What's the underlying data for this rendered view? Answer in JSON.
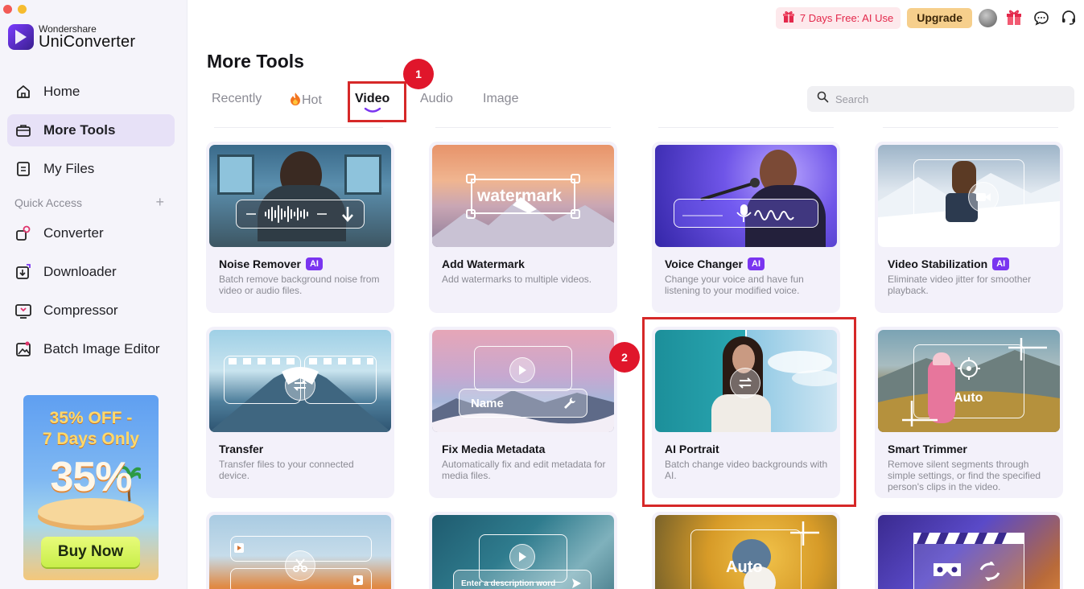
{
  "app": {
    "brand": "Wondershare",
    "product": "UniConverter"
  },
  "topbar": {
    "trial_label": "7 Days Free: AI Use",
    "upgrade_label": "Upgrade"
  },
  "sidebar": {
    "items": [
      {
        "label": "Home",
        "icon": "home-icon"
      },
      {
        "label": "More Tools",
        "icon": "toolbox-icon",
        "active": true
      },
      {
        "label": "My Files",
        "icon": "file-icon"
      }
    ],
    "quick_access_label": "Quick Access",
    "quick_items": [
      {
        "label": "Converter",
        "icon": "converter-icon"
      },
      {
        "label": "Downloader",
        "icon": "downloader-icon"
      },
      {
        "label": "Compressor",
        "icon": "compressor-icon"
      },
      {
        "label": "Batch Image Editor",
        "icon": "image-editor-icon"
      }
    ]
  },
  "promo": {
    "line1": "35% OFF -",
    "line2": "7 Days Only",
    "big": "35%",
    "button": "Buy Now"
  },
  "main": {
    "title": "More Tools",
    "tabs": [
      "Recently",
      "Hot",
      "Video",
      "Audio",
      "Image"
    ],
    "active_tab": "Video",
    "search_placeholder": "Search"
  },
  "annotations": {
    "badge1": "1",
    "badge2": "2"
  },
  "thumb_text": {
    "watermark": "watermark",
    "name": "Name",
    "auto": "Auto",
    "description": "Enter a description word"
  },
  "cards": [
    {
      "title": "Noise Remover",
      "ai": "AI",
      "desc": "Batch remove background noise from video or audio files."
    },
    {
      "title": "Add Watermark",
      "desc": "Add watermarks to multiple videos."
    },
    {
      "title": "Voice Changer",
      "ai": "AI",
      "desc": "Change your voice and have fun listening to your modified voice."
    },
    {
      "title": "Video Stabilization",
      "ai": "AI",
      "desc": "Eliminate video jitter for smoother playback."
    },
    {
      "title": "Transfer",
      "desc": "Transfer files to your connected device."
    },
    {
      "title": "Fix Media Metadata",
      "desc": "Automatically fix and edit metadata for media files."
    },
    {
      "title": "AI Portrait",
      "desc": "Batch change video backgrounds with AI."
    },
    {
      "title": "Smart Trimmer",
      "desc": "Remove silent segments through simple settings, or find the specified person's clips in the video."
    }
  ],
  "colors": {
    "accent": "#7a35f0",
    "annotation": "#d62828",
    "active_nav": "#e7e1f7",
    "upgrade": "#f6cf8c"
  }
}
